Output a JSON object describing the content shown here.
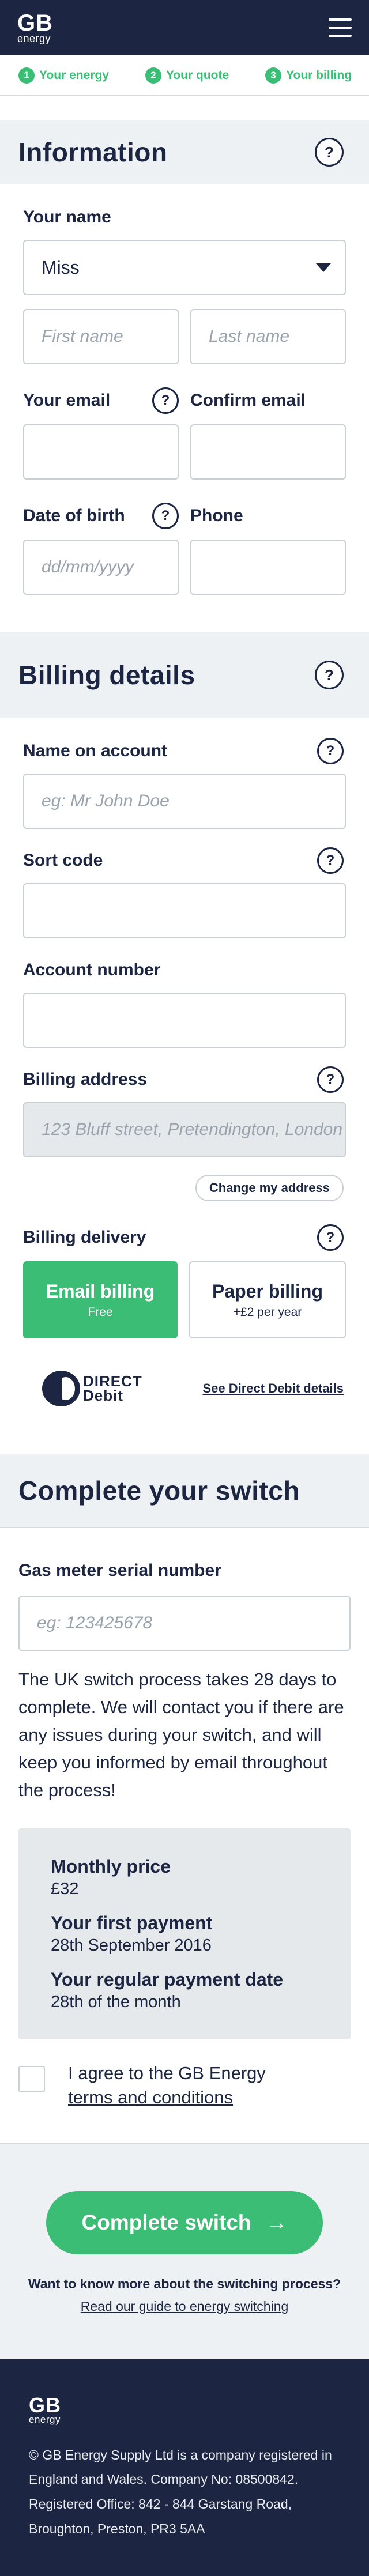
{
  "header": {
    "logo_main": "GB",
    "logo_sub": "energy",
    "menu_icon": "hamburger-menu-icon"
  },
  "steps": [
    {
      "num": "1",
      "label": "Your energy"
    },
    {
      "num": "2",
      "label": "Your quote"
    },
    {
      "num": "3",
      "label": "Your billing"
    }
  ],
  "information": {
    "title": "Information",
    "name_label": "Your name",
    "title_select_value": "Miss",
    "first_name_placeholder": "First name",
    "last_name_placeholder": "Last name",
    "email_label": "Your email",
    "confirm_email_label": "Confirm email",
    "dob_label": "Date of birth",
    "dob_placeholder": "dd/mm/yyyy",
    "phone_label": "Phone"
  },
  "billing": {
    "title": "Billing details",
    "name_on_account_label": "Name on account",
    "name_on_account_placeholder": "eg: Mr John Doe",
    "sort_code_label": "Sort code",
    "account_number_label": "Account number",
    "billing_address_label": "Billing address",
    "billing_address_value": "123 Bluff street, Pretendington, London",
    "change_address_label": "Change my address",
    "delivery_label": "Billing delivery",
    "email_billing_title": "Email billing",
    "email_billing_sub": "Free",
    "paper_billing_title": "Paper billing",
    "paper_billing_sub": "+£2 per year",
    "direct_debit_logo_line1": "DIRECT",
    "direct_debit_logo_line2": "Debit",
    "direct_debit_link": "See Direct Debit details"
  },
  "complete": {
    "title": "Complete your switch",
    "gas_meter_label": "Gas meter serial number",
    "gas_meter_placeholder": "eg: 123425678",
    "info_text": "The UK switch process takes 28 days to complete. We will contact you if there are any issues during your switch, and will keep you informed by email throughout the process!",
    "monthly_price_label": "Monthly price",
    "monthly_price_value": "£32",
    "first_payment_label": "Your first payment",
    "first_payment_value": "28th September 2016",
    "regular_payment_label": "Your regular payment date",
    "regular_payment_value": "28th of the month",
    "agree_text": "I agree to the GB Energy",
    "terms_link": "terms and conditions"
  },
  "cta": {
    "button_label": "Complete switch",
    "arrow": "→",
    "note": "Want to know more about the switching process?",
    "guide_link": "Read our guide to energy switching"
  },
  "footer": {
    "logo_main": "GB",
    "logo_sub": "energy",
    "text": "© GB Energy Supply Ltd is a company registered in England and Wales. Company No: 08500842. Registered Office: 842 - 844 Garstang Road, Broughton, Preston, PR3 5AA"
  },
  "colors": {
    "navy": "#1c2541",
    "green": "#3bbd75",
    "section_bg": "#eef1f3"
  }
}
